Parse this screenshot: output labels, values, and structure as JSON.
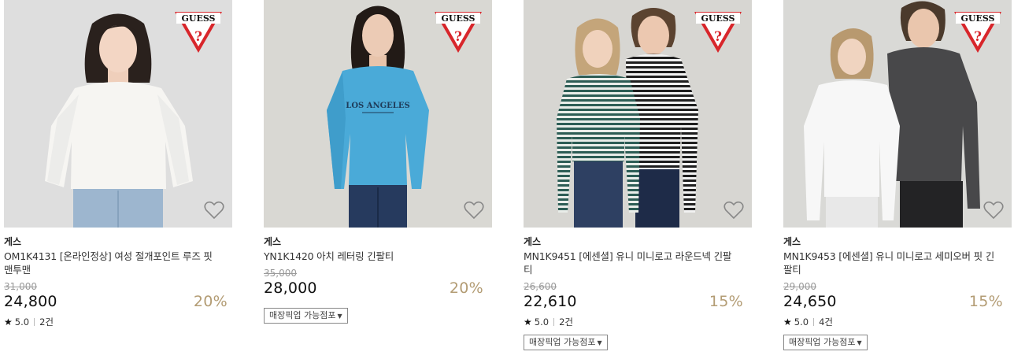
{
  "products": [
    {
      "brand": "게스",
      "name": "OM1K4131 [온라인정상] 여성 절개포인트 루즈 핏 맨투맨",
      "original_price": "31,000",
      "price": "24,800",
      "discount": "20%",
      "rating": "5.0",
      "review_count": "2건",
      "pickup_label": "",
      "logo_text": "GUESS",
      "wishlist_icon": "heart-outline-icon"
    },
    {
      "brand": "게스",
      "name": "YN1K1420 아치 레터링 긴팔티",
      "original_price": "35,000",
      "price": "28,000",
      "discount": "20%",
      "rating": "",
      "review_count": "",
      "pickup_label": "매장픽업 가능점포",
      "logo_text": "GUESS",
      "shirt_print": "LOS ANGELES",
      "wishlist_icon": "heart-outline-icon"
    },
    {
      "brand": "게스",
      "name": "MN1K9451 [에센셜] 유니 미니로고 라운드넥 긴팔티",
      "original_price": "26,600",
      "price": "22,610",
      "discount": "15%",
      "rating": "5.0",
      "review_count": "2건",
      "pickup_label": "매장픽업 가능점포",
      "logo_text": "GUESS",
      "wishlist_icon": "heart-outline-icon"
    },
    {
      "brand": "게스",
      "name": "MN1K9453 [에센셜] 유니 미니로고 세미오버 핏 긴팔티",
      "original_price": "29,000",
      "price": "24,650",
      "discount": "15%",
      "rating": "5.0",
      "review_count": "4건",
      "pickup_label": "매장픽업 가능점포",
      "logo_text": "GUESS",
      "wishlist_icon": "heart-outline-icon"
    }
  ],
  "colors": {
    "discount": "#b39c74",
    "logo_red": "#d8262b"
  }
}
